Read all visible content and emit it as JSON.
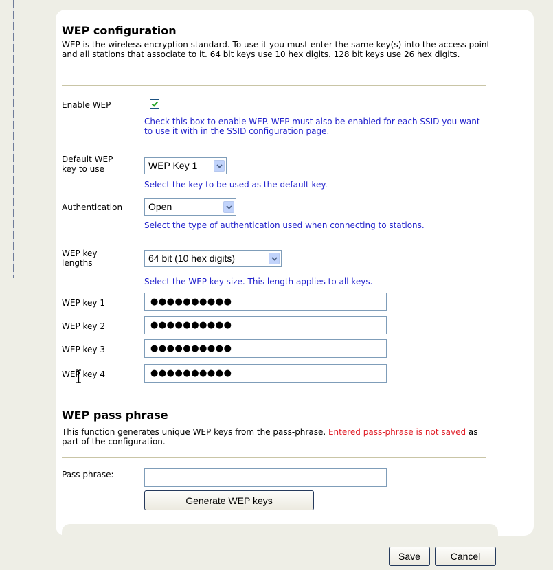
{
  "wep_config": {
    "title": "WEP configuration",
    "description": "WEP is the wireless encryption standard. To use it you must enter the same key(s) into the access point and all stations that associate to it. 64 bit keys use 10 hex digits. 128 bit keys use 26 hex digits."
  },
  "enable_wep": {
    "label": "Enable WEP",
    "checked": true,
    "hint": "Check this box to enable WEP. WEP must also be enabled for each SSID you want to use it with in the SSID configuration page."
  },
  "default_key": {
    "label_line1": "Default WEP",
    "label_line2": "key to use",
    "value": "WEP Key 1",
    "hint": "Select the key to be used as the default key."
  },
  "authentication": {
    "label": "Authentication",
    "value": "Open",
    "hint": "Select the type of authentication used when connecting to stations."
  },
  "key_length": {
    "label_line1": "WEP key",
    "label_line2": "lengths",
    "value": "64 bit (10 hex digits)",
    "hint": "Select the WEP key size. This length applies to all keys."
  },
  "wep_keys": [
    {
      "label": "WEP key 1",
      "masked_value": "●●●●●●●●●●"
    },
    {
      "label": "WEP key 2",
      "masked_value": "●●●●●●●●●●"
    },
    {
      "label": "WEP key 3",
      "masked_value": "●●●●●●●●●●"
    },
    {
      "label": "WEP key 4",
      "masked_value": "●●●●●●●●●●"
    }
  ],
  "pass_phrase": {
    "title": "WEP pass phrase",
    "desc_start": "This function generates unique WEP keys from the pass-phrase. ",
    "desc_warning": "Entered pass-phrase is not saved",
    "desc_end": " as part of the configuration.",
    "label": "Pass phrase:",
    "value": "",
    "generate_label": "Generate WEP keys"
  },
  "footer": {
    "save_label": "Save",
    "cancel_label": "Cancel"
  },
  "colors": {
    "hint_text": "#2222cc",
    "warning_text": "#e0202a",
    "page_background": "#eeeee6"
  }
}
